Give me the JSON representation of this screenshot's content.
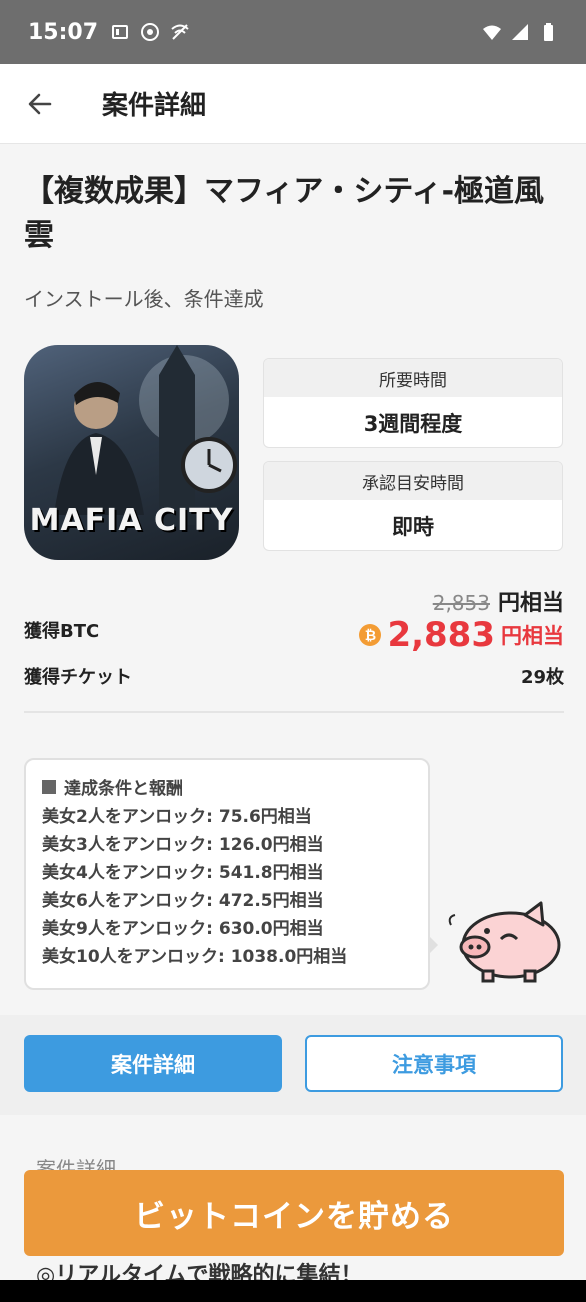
{
  "status_bar": {
    "time": "15:07"
  },
  "header": {
    "title": "案件詳細"
  },
  "campaign": {
    "title": "【複数成果】マフィア・シティ-極道風雲",
    "subtitle": "インストール後、条件達成",
    "app_icon_text": "MAFIA CITY"
  },
  "info_boxes": [
    {
      "label": "所要時間",
      "value": "3週間程度"
    },
    {
      "label": "承認目安時間",
      "value": "即時"
    }
  ],
  "rewards": {
    "btc_label": "獲得BTC",
    "old_amount": "2,853",
    "old_unit": "円相当",
    "new_amount": "2,883",
    "new_unit": "円相当",
    "ticket_label": "獲得チケット",
    "ticket_value": "29枚"
  },
  "conditions": {
    "heading": "達成条件と報酬",
    "items": [
      "美女2人をアンロック: 75.6円相当",
      "美女3人をアンロック: 126.0円相当",
      "美女4人をアンロック: 541.8円相当",
      "美女6人をアンロック: 472.5円相当",
      "美女9人をアンロック: 630.0円相当",
      "美女10人をアンロック: 1038.0円相当"
    ]
  },
  "tabs": [
    {
      "label": "案件詳細",
      "active": true
    },
    {
      "label": "注意事項",
      "active": false
    }
  ],
  "details": {
    "section_label": "案件詳細",
    "first_line": "◎リアルタイムで戦略的に集結！"
  },
  "cta": {
    "label": "ビットコインを貯める"
  },
  "colors": {
    "accent_blue": "#3d9be0",
    "price_red": "#e8383e",
    "cta_orange": "#eb993c",
    "btc_orange": "#f39c34"
  }
}
